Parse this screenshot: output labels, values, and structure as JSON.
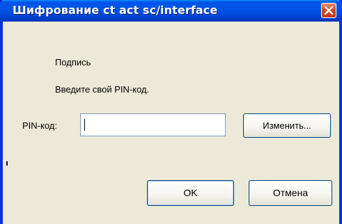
{
  "window": {
    "title": "Шифрование ct act sc/interface"
  },
  "dialog": {
    "heading": "Подпись",
    "instruction": "Введите свой PIN-код.",
    "pin_label": "PIN-код:",
    "pin_value": "",
    "change_button": "Изменить...",
    "ok_button": "OK",
    "cancel_button": "Отмена"
  },
  "icons": {
    "close": "close-icon"
  },
  "colors": {
    "titlebar": "#0055e5",
    "window_border": "#0831d9",
    "dialog_background": "#ece9d8",
    "close_button": "#d54a25"
  }
}
